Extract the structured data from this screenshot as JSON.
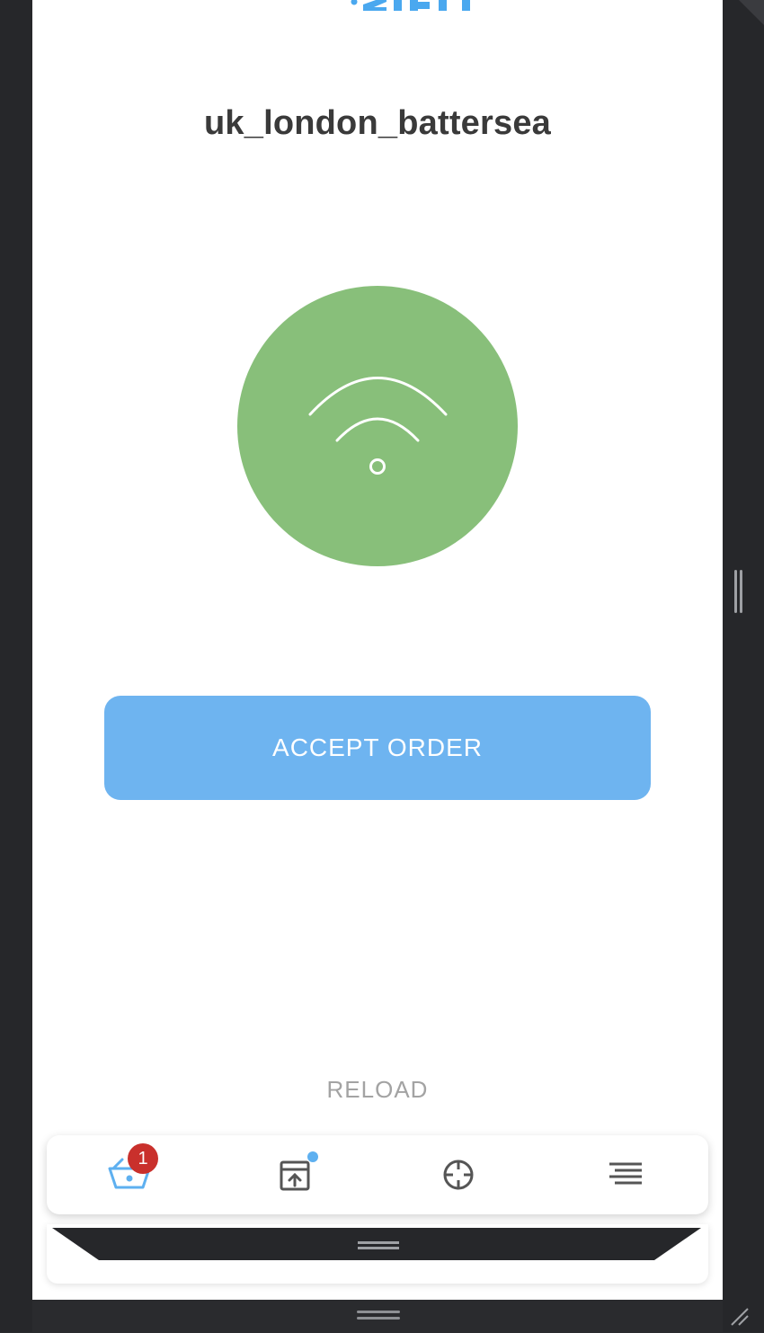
{
  "app": {
    "store_name": "uk_london_battersea",
    "brand_color": "#4aa8ef"
  },
  "status": {
    "icon": "wifi-signal-icon",
    "color": "#88bf7a"
  },
  "actions": {
    "accept_label": "ACCEPT ORDER",
    "reload_label": "RELOAD"
  },
  "nav": {
    "items": [
      {
        "name": "basket",
        "icon": "basket-icon",
        "badge": "1",
        "active": true
      },
      {
        "name": "archive",
        "icon": "archive-upload-icon",
        "dot": true
      },
      {
        "name": "target",
        "icon": "crosshair-icon"
      },
      {
        "name": "menu",
        "icon": "menu-lines-icon"
      }
    ]
  }
}
